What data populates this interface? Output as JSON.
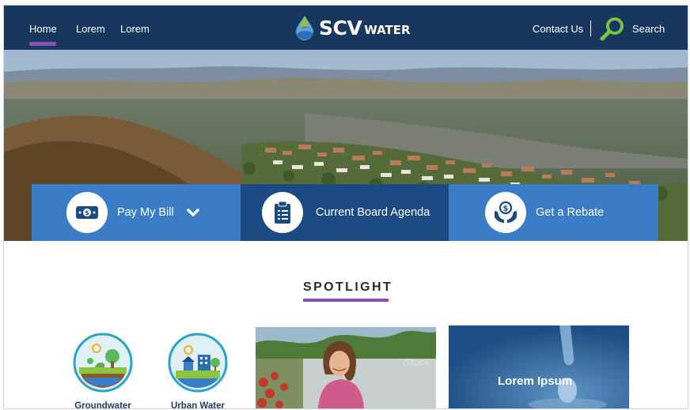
{
  "nav": {
    "items": [
      {
        "label": "Home",
        "active": true
      },
      {
        "label": "Lorem"
      },
      {
        "label": "Lorem"
      }
    ],
    "logo": {
      "primary": "SCV",
      "secondary": "WATER"
    },
    "contact_label": "Contact Us",
    "search_label": "Search",
    "search_icon": "magnifier-icon"
  },
  "actions": [
    {
      "label": "Pay My Bill",
      "icon": "money-bill-icon",
      "has_dropdown": true
    },
    {
      "label": "Current Board Agenda",
      "icon": "clipboard-icon"
    },
    {
      "label": "Get a Rebate",
      "icon": "hands-dollar-icon"
    }
  ],
  "spotlight": {
    "title": "SPOTLIGHT",
    "categories": [
      {
        "label": "Groundwater",
        "icon": "groundwater-icon"
      },
      {
        "label": "Urban Water",
        "icon": "urban-water-icon"
      }
    ],
    "card_title": "Lorem Ipsum"
  },
  "colors": {
    "nav_bg": "#17375e",
    "accent_purple": "#8a4fb1",
    "action_light": "#3a7dc6",
    "action_dark": "#1c4a82",
    "search_green": "#7cc242"
  }
}
